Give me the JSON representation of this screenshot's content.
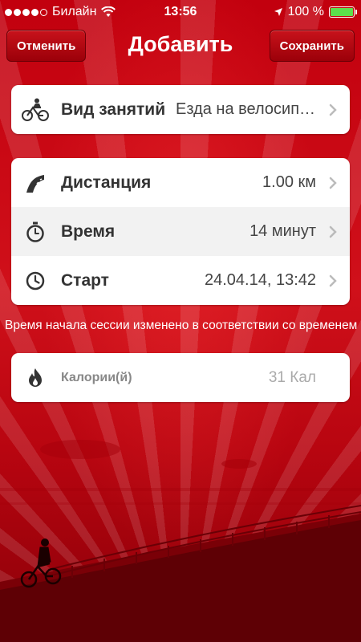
{
  "status_bar": {
    "carrier": "Билайн",
    "time": "13:56",
    "battery_percent": "100 %",
    "battery_level": 1.0,
    "signal_bars_filled": 4,
    "signal_bars_total": 5
  },
  "nav": {
    "title": "Добавить",
    "cancel_label": "Отменить",
    "save_label": "Сохранить"
  },
  "activity": {
    "label": "Вид занятий",
    "value": "Езда на велосипеде"
  },
  "details": [
    {
      "label": "Дистанция",
      "value": "1.00 км"
    },
    {
      "label": "Время",
      "value": "14 минут"
    },
    {
      "label": "Старт",
      "value": "24.04.14, 13:42"
    }
  ],
  "note": "Время начала сессии изменено в соответствии со временем",
  "calories": {
    "label": "Калории(й)",
    "value": "31 Кал"
  },
  "icons": {
    "activity": "cyclist-icon",
    "distance": "road-icon",
    "duration": "stopwatch-icon",
    "start": "clock-icon",
    "calories": "flame-icon"
  },
  "colors": {
    "accent": "#c2000e",
    "battery": "#5ce04b"
  }
}
